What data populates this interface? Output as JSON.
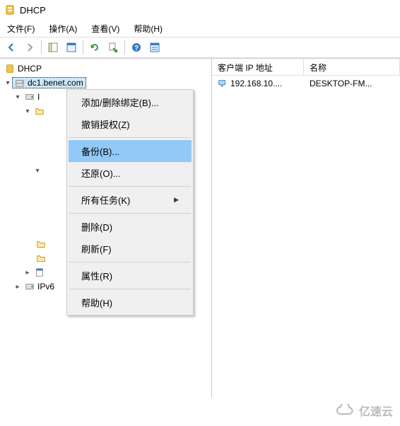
{
  "title": "DHCP",
  "menubar": {
    "file": "文件(F)",
    "action": "操作(A)",
    "view": "查看(V)",
    "help": "帮助(H)"
  },
  "tree": {
    "root": "DHCP",
    "server": "dc1.benet.com",
    "ipv4_partial": "I",
    "ipv6": "IPv6"
  },
  "columns": {
    "ip": "客户端 IP 地址",
    "name": "名称"
  },
  "listrow": {
    "ip": "192.168.10....",
    "name": "DESKTOP-FM..."
  },
  "context_menu": {
    "add_remove_binding": "添加/删除绑定(B)...",
    "revoke_auth": "撤销授权(Z)",
    "backup": "备份(B)...",
    "restore": "还原(O)...",
    "all_tasks": "所有任务(K)",
    "delete": "删除(D)",
    "refresh": "刷新(F)",
    "properties": "属性(R)",
    "help": "帮助(H)"
  },
  "watermark": "亿速云"
}
